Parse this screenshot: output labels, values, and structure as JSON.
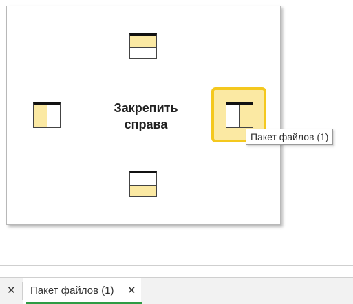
{
  "dock_panel": {
    "caption": "Закрепить справа",
    "targets": {
      "top": "dock-top",
      "left": "dock-left",
      "right": "dock-right",
      "bottom": "dock-bottom"
    },
    "highlight_color": "#f4c81e",
    "fill_color": "#fbe9a3"
  },
  "tooltip": {
    "text": "Пакет файлов (1)"
  },
  "tabs": {
    "previous": {
      "label_fragment": ")",
      "close_symbol": "✕"
    },
    "active": {
      "label": "Пакет файлов (1)",
      "close_symbol": "✕",
      "accent_color": "#2e9b44"
    }
  }
}
